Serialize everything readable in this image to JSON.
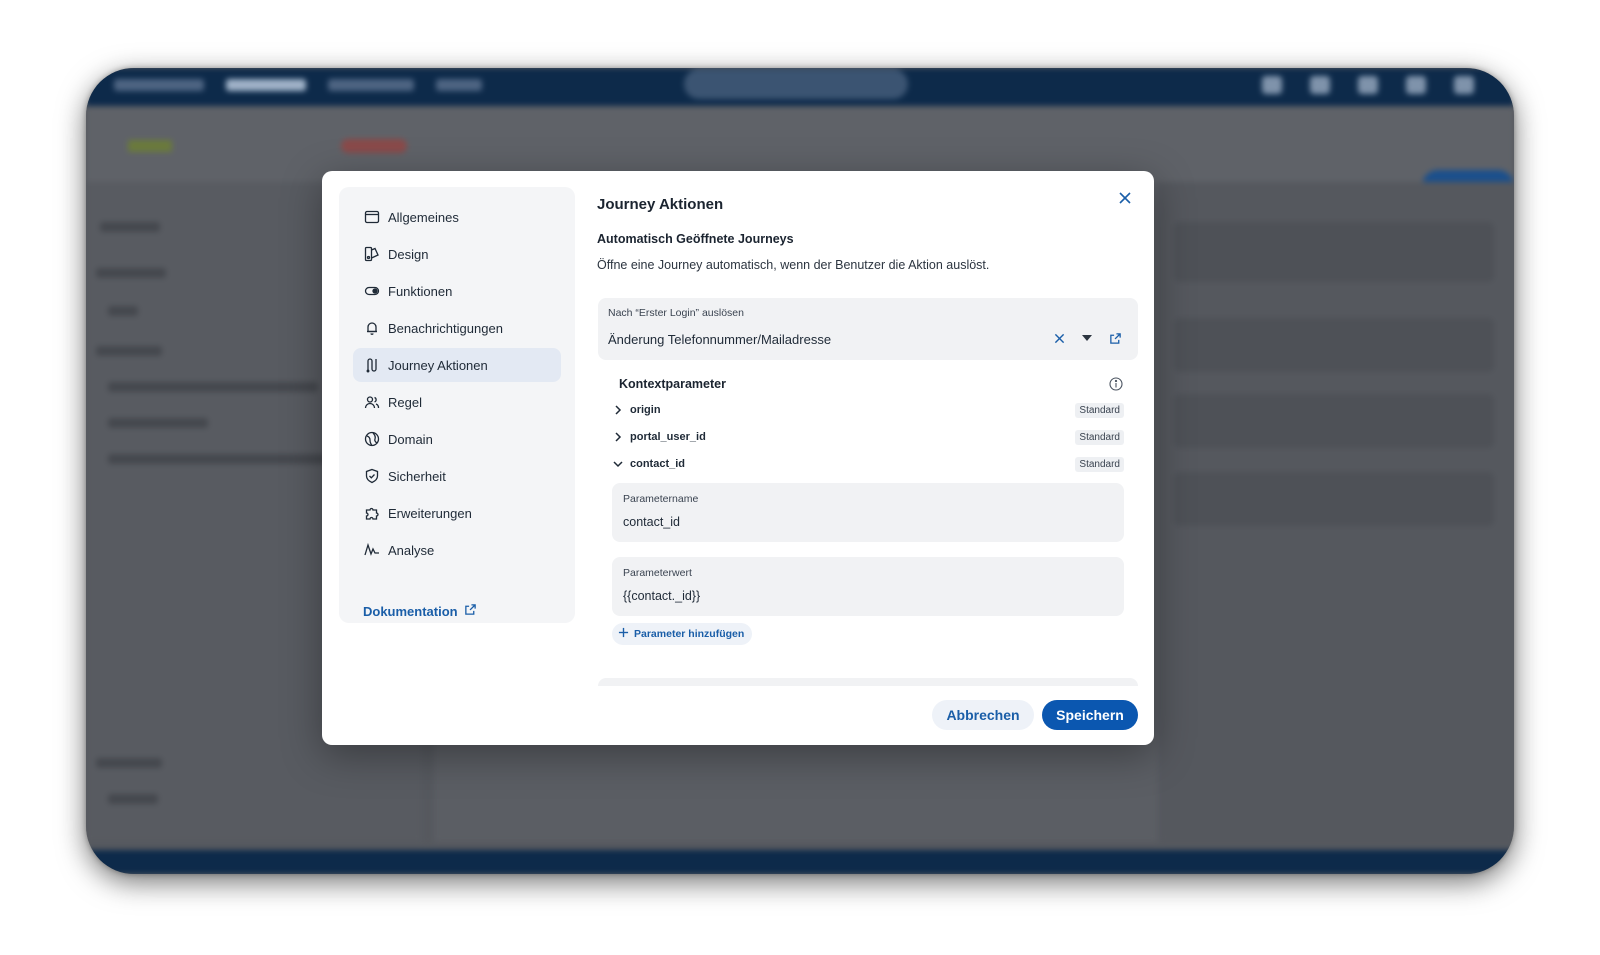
{
  "sidebar": {
    "items": [
      {
        "label": "Allgemeines",
        "icon": "browser-window-icon"
      },
      {
        "label": "Design",
        "icon": "palette-icon"
      },
      {
        "label": "Funktionen",
        "icon": "toggle-icon"
      },
      {
        "label": "Benachrichtigungen",
        "icon": "bell-icon"
      },
      {
        "label": "Journey Aktionen",
        "icon": "journey-icon",
        "active": true
      },
      {
        "label": "Regel",
        "icon": "users-icon"
      },
      {
        "label": "Domain",
        "icon": "globe-icon"
      },
      {
        "label": "Sicherheit",
        "icon": "shield-icon"
      },
      {
        "label": "Erweiterungen",
        "icon": "puzzle-icon"
      },
      {
        "label": "Analyse",
        "icon": "pulse-icon"
      }
    ],
    "doc_link": "Dokumentation"
  },
  "modal": {
    "title": "Journey Aktionen",
    "section_title": "Automatisch Geöffnete Journeys",
    "description": "Öffne eine Journey automatisch, wenn der Benutzer die Aktion auslöst.",
    "trigger": {
      "label": "Nach “Erster Login” auslösen",
      "value": "Änderung Telefonnummer/Mailadresse"
    },
    "context": {
      "title": "Kontextparameter",
      "params": [
        {
          "name": "origin",
          "tag": "Standard",
          "expanded": false
        },
        {
          "name": "portal_user_id",
          "tag": "Standard",
          "expanded": false
        },
        {
          "name": "contact_id",
          "tag": "Standard",
          "expanded": true
        }
      ],
      "param_name_label": "Parametername",
      "param_name_value": "contact_id",
      "param_value_label": "Parameterwert",
      "param_value_value": "{{contact._id}}",
      "add_param": "Parameter hinzufügen"
    },
    "cancel": "Abbrechen",
    "save": "Speichern"
  },
  "colors": {
    "accent": "#0b57b0",
    "link": "#1a5ea8",
    "active_nav": "#e3e9f3",
    "field_bg": "#f1f2f4"
  }
}
